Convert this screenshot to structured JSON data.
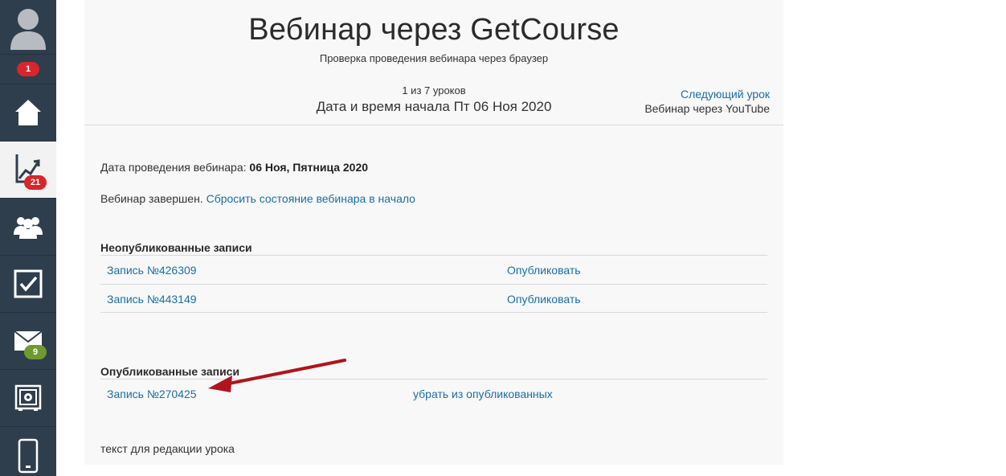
{
  "sidebar": {
    "notifications_count": "1",
    "stats_count": "21",
    "mail_count": "9",
    "items": [
      {
        "name": "avatar"
      },
      {
        "name": "home-icon"
      },
      {
        "name": "stats-icon"
      },
      {
        "name": "users-icon"
      },
      {
        "name": "tasks-icon"
      },
      {
        "name": "mail-icon"
      },
      {
        "name": "safe-icon"
      },
      {
        "name": "mobile-icon"
      }
    ]
  },
  "header": {
    "title": "Вебинар через GetCourse",
    "subtitle": "Проверка проведения вебинара через браузер",
    "lesson_count": "1 из 7 уроков",
    "lesson_date": "Дата и время начала Пт 06 Ноя 2020",
    "next_link": "Следующий урок",
    "next_name": "Вебинар через YouTube"
  },
  "webinar": {
    "date_label": "Дата проведения вебинара: ",
    "date_value": "06 Ноя, Пятница 2020",
    "status_text": "Вебинар завершен. ",
    "reset_link": "Сбросить состояние вебинара в начало"
  },
  "unpublished": {
    "title": "Неопубликованные записи",
    "rows": [
      {
        "name": "Запись №426309",
        "action": "Опубликовать"
      },
      {
        "name": "Запись №443149",
        "action": "Опубликовать"
      }
    ]
  },
  "published": {
    "title": "Опубликованные записи",
    "rows": [
      {
        "name": "Запись №270425",
        "action": "убрать из опубликованных"
      }
    ]
  },
  "footer_text": "текст для редакции урока",
  "colors": {
    "sidebar_bg": "#2f3e4d",
    "link": "#1a6fa8",
    "badge_red": "#d7262c",
    "badge_green": "#6f9a30",
    "arrow": "#b0141c"
  }
}
